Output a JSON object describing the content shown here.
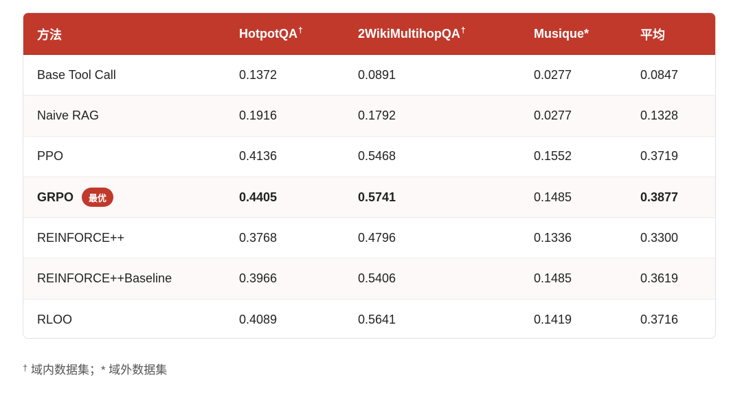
{
  "table": {
    "headers": [
      {
        "label": "方法",
        "sup": ""
      },
      {
        "label": "HotpotQA",
        "sup": "†"
      },
      {
        "label": "2WikiMultihopQA",
        "sup": "†"
      },
      {
        "label": "Musique*",
        "sup": ""
      },
      {
        "label": "平均",
        "sup": ""
      }
    ],
    "rows": [
      {
        "method": "Base Tool Call",
        "hotpotqa": "0.1372",
        "wiki": "0.0891",
        "musique": "0.0277",
        "avg": "0.0847"
      },
      {
        "method": "Naive RAG",
        "hotpotqa": "0.1916",
        "wiki": "0.1792",
        "musique": "0.0277",
        "avg": "0.1328"
      },
      {
        "method": "PPO",
        "hotpotqa": "0.4136",
        "wiki": "0.5468",
        "musique": "0.1552",
        "avg": "0.3719"
      },
      {
        "method": "GRPO",
        "badge": "最优",
        "hotpotqa": "0.4405",
        "wiki": "0.5741",
        "musique": "0.1485",
        "avg": "0.3877"
      },
      {
        "method": "REINFORCE++",
        "hotpotqa": "0.3768",
        "wiki": "0.4796",
        "musique": "0.1336",
        "avg": "0.3300"
      },
      {
        "method": "REINFORCE++Baseline",
        "hotpotqa": "0.3966",
        "wiki": "0.5406",
        "musique": "0.1485",
        "avg": "0.3619"
      },
      {
        "method": "RLOO",
        "hotpotqa": "0.4089",
        "wiki": "0.5641",
        "musique": "0.1419",
        "avg": "0.3716"
      }
    ]
  },
  "footnote": {
    "dagger": "†",
    "text": " 域内数据集；* 域外数据集"
  },
  "colors": {
    "header_bg": "#c0392b",
    "badge_bg": "#c0392b",
    "alt_row_bg": "#fdf9f8"
  }
}
